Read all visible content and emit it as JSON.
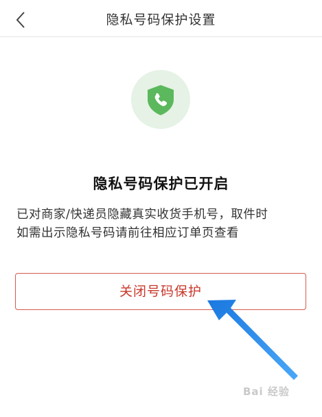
{
  "header": {
    "title": "隐私号码保护设置",
    "back_icon": "chevron-left-icon"
  },
  "status": {
    "icon": "shield-phone-icon",
    "icon_color": "#5cb85c",
    "title": "隐私号码保护已开启",
    "description_lines": [
      "已对商家/快递员隐藏真实收货手机号，取件时",
      "如需出示隐私号码请前往相应订单页查看"
    ]
  },
  "actions": {
    "close_label": "关闭号码保护",
    "accent_color": "#c8362a"
  },
  "annotation": {
    "arrow_color": "#2e8ff0"
  },
  "watermark": {
    "text": "Bai 经验"
  }
}
